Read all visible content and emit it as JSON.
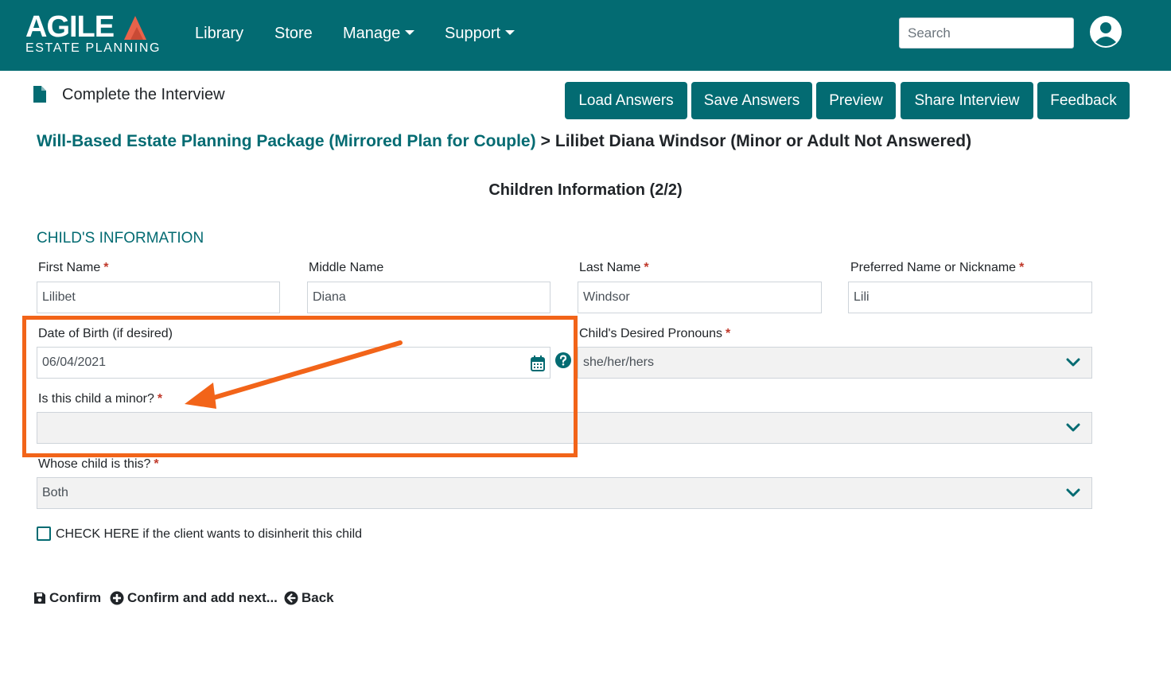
{
  "brand": {
    "name": "AGILE",
    "subtitle": "ESTATE PLANNING"
  },
  "nav": {
    "items": [
      {
        "label": "Library"
      },
      {
        "label": "Store"
      },
      {
        "label": "Manage"
      },
      {
        "label": "Support"
      }
    ],
    "search_placeholder": "Search"
  },
  "toolbar": {
    "title": "Complete the Interview",
    "buttons": [
      "Load Answers",
      "Save Answers",
      "Preview",
      "Share Interview",
      "Feedback"
    ]
  },
  "breadcrumb": {
    "parent": "Will-Based Estate Planning Package (Mirrored Plan for Couple)",
    "separator": ">",
    "current": "Lilibet Diana Windsor (Minor or Adult Not Answered)"
  },
  "section_title": "Children Information (2/2)",
  "group_title": "CHILD'S INFORMATION",
  "form": {
    "first_name": {
      "label": "First Name",
      "value": "Lilibet",
      "required": "*"
    },
    "middle_name": {
      "label": "Middle Name",
      "value": "Diana"
    },
    "last_name": {
      "label": "Last Name",
      "value": "Windsor",
      "required": "*"
    },
    "preferred_name": {
      "label": "Preferred Name or Nickname",
      "value": "Lili",
      "required": "*"
    },
    "dob": {
      "label": "Date of Birth (if desired)",
      "value": "06/04/2021"
    },
    "pronouns": {
      "label": "Child's Desired Pronouns",
      "value": "she/her/hers",
      "required": "*"
    },
    "is_minor": {
      "label": "Is this child a minor?",
      "value": "",
      "required": "*"
    },
    "whose_child": {
      "label": "Whose child is this?",
      "value": "Both",
      "required": "*"
    },
    "disinherit": {
      "label": "CHECK HERE if the client wants to disinherit this child",
      "checked": false
    }
  },
  "actions": {
    "confirm": "Confirm",
    "confirm_next": "Confirm and add next...",
    "back": "Back"
  },
  "colors": {
    "brand_teal": "#036b72",
    "annotation_orange": "#f26419",
    "logo_triangle": "#e8624a",
    "required_red": "#c0392b"
  }
}
